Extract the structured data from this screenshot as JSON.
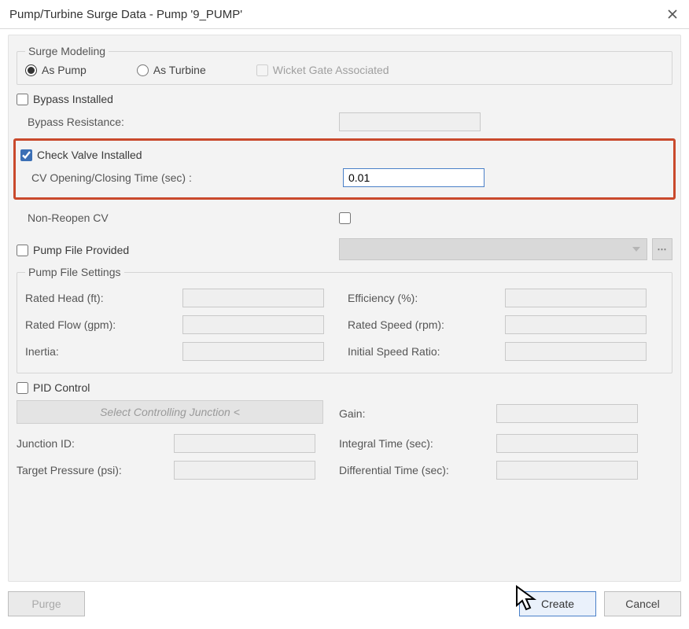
{
  "window": {
    "title": "Pump/Turbine Surge Data - Pump '9_PUMP'"
  },
  "surgeModeling": {
    "legend": "Surge Modeling",
    "asPump": "As Pump",
    "asTurbine": "As Turbine",
    "wicketGate": "Wicket Gate Associated"
  },
  "bypass": {
    "installed": "Bypass Installed",
    "resistance": "Bypass Resistance:"
  },
  "checkValve": {
    "installed": "Check Valve Installed",
    "timeLabel": "CV Opening/Closing Time (sec) :",
    "timeValue": "0.01",
    "nonReopen": "Non-Reopen CV"
  },
  "pumpFile": {
    "provided": "Pump File Provided",
    "settingsLegend": "Pump File Settings",
    "ratedHead": "Rated Head (ft):",
    "ratedFlow": "Rated Flow (gpm):",
    "inertia": "Inertia:",
    "efficiency": "Efficiency (%):",
    "ratedSpeed": "Rated Speed (rpm):",
    "initialSpeedRatio": "Initial Speed Ratio:"
  },
  "pid": {
    "legend": "PID Control",
    "selectJunction": "Select Controlling Junction <",
    "junctionId": "Junction ID:",
    "targetPressure": "Target Pressure (psi):",
    "gain": "Gain:",
    "integralTime": "Integral Time (sec):",
    "differentialTime": "Differential Time (sec):"
  },
  "footer": {
    "purge": "Purge",
    "create": "Create",
    "cancel": "Cancel"
  }
}
